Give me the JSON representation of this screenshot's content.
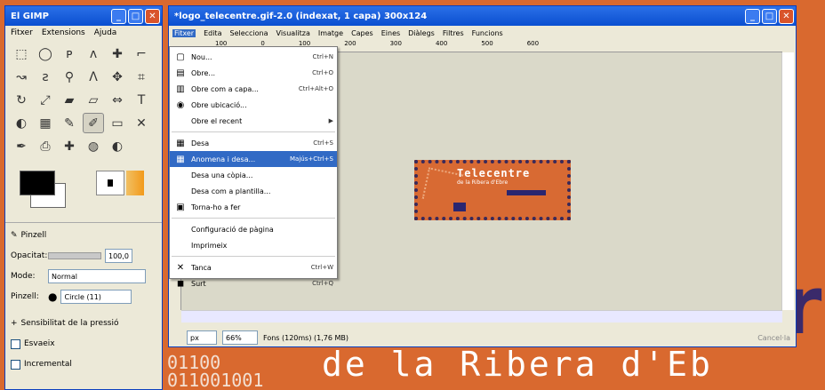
{
  "desktop": {
    "big_letter": "r",
    "background_text": "de la Ribera d'Eb",
    "binary_lines": [
      "01100",
      "011001001"
    ]
  },
  "toolbox": {
    "title": "El GIMP",
    "menu": [
      "Fitxer",
      "Extensions",
      "Ajuda"
    ],
    "tool_icons": [
      "rect-select-icon",
      "ellipse-select-icon",
      "lasso-icon",
      "fuzzy-select-icon",
      "color-select-icon",
      "scissors-icon",
      "paths-icon",
      "color-picker-icon",
      "zoom-icon",
      "measure-icon",
      "move-icon",
      "crop-icon",
      "rotate-icon",
      "scale-icon",
      "shear-icon",
      "perspective-icon",
      "flip-icon",
      "text-icon",
      "bucket-fill-icon",
      "blend-icon",
      "pencil-icon",
      "paintbrush-icon",
      "eraser-icon",
      "airbrush-icon",
      "ink-icon",
      "clone-icon",
      "heal-icon",
      "smudge-icon",
      "dodge-icon"
    ],
    "options": {
      "title": "Pinzell",
      "opacity_label": "Opacitat:",
      "opacity_value": "100,0",
      "mode_label": "Mode:",
      "mode_value": "Normal",
      "brush_label": "Pinzell:",
      "brush_value": "Circle (11)",
      "pressure_label": "Sensibilitat de la pressió",
      "fade_label": "Esvaeix",
      "incremental_label": "Incremental"
    }
  },
  "image_window": {
    "title": "*logo_telecentre.gif-2.0 (indexat, 1 capa) 300x124",
    "menu": [
      "Fitxer",
      "Edita",
      "Selecciona",
      "Visualitza",
      "Imatge",
      "Capes",
      "Eines",
      "Diàlegs",
      "Filtres",
      "Funcions"
    ],
    "open_menu": "Fitxer",
    "ruler_marks": [
      "100",
      "0",
      "100",
      "200",
      "300",
      "400",
      "500",
      "600"
    ],
    "status": {
      "unit": "px",
      "zoom": "66%",
      "info": "Fons (120ms) (1,76 MB)",
      "cancel": "Cancel·la"
    }
  },
  "logo": {
    "line1": "Telecentre",
    "line2": "de la Ribera d'Ebre"
  },
  "file_menu": {
    "items": [
      {
        "icon": "new-icon",
        "glyph": "▢",
        "label": "Nou...",
        "shortcut": "Ctrl+N"
      },
      {
        "icon": "open-icon",
        "glyph": "▤",
        "label": "Obre...",
        "shortcut": "Ctrl+O"
      },
      {
        "icon": "open-layer-icon",
        "glyph": "▥",
        "label": "Obre com a capa...",
        "shortcut": "Ctrl+Alt+O"
      },
      {
        "icon": "open-location-icon",
        "glyph": "◉",
        "label": "Obre ubicació...",
        "shortcut": ""
      },
      {
        "icon": "",
        "glyph": "",
        "label": "Obre el recent",
        "shortcut": "▶"
      },
      {
        "sep": true
      },
      {
        "icon": "save-icon",
        "glyph": "▦",
        "label": "Desa",
        "shortcut": "Ctrl+S"
      },
      {
        "icon": "save-as-icon",
        "glyph": "▦",
        "label": "Anomena i desa...",
        "shortcut": "Majús+Ctrl+S",
        "selected": true
      },
      {
        "icon": "",
        "glyph": "",
        "label": "Desa una còpia...",
        "shortcut": ""
      },
      {
        "icon": "",
        "glyph": "",
        "label": "Desa com a plantilla...",
        "shortcut": ""
      },
      {
        "icon": "revert-icon",
        "glyph": "▣",
        "label": "Torna-ho a fer",
        "shortcut": ""
      },
      {
        "sep": true
      },
      {
        "icon": "",
        "glyph": "",
        "label": "Configuració de pàgina",
        "shortcut": ""
      },
      {
        "icon": "",
        "glyph": "",
        "label": "Imprimeix",
        "shortcut": ""
      },
      {
        "sep": true
      },
      {
        "icon": "close-icon",
        "glyph": "✕",
        "label": "Tanca",
        "shortcut": "Ctrl+W"
      },
      {
        "icon": "quit-icon",
        "glyph": "◼",
        "label": "Surt",
        "shortcut": "Ctrl+Q"
      }
    ]
  }
}
